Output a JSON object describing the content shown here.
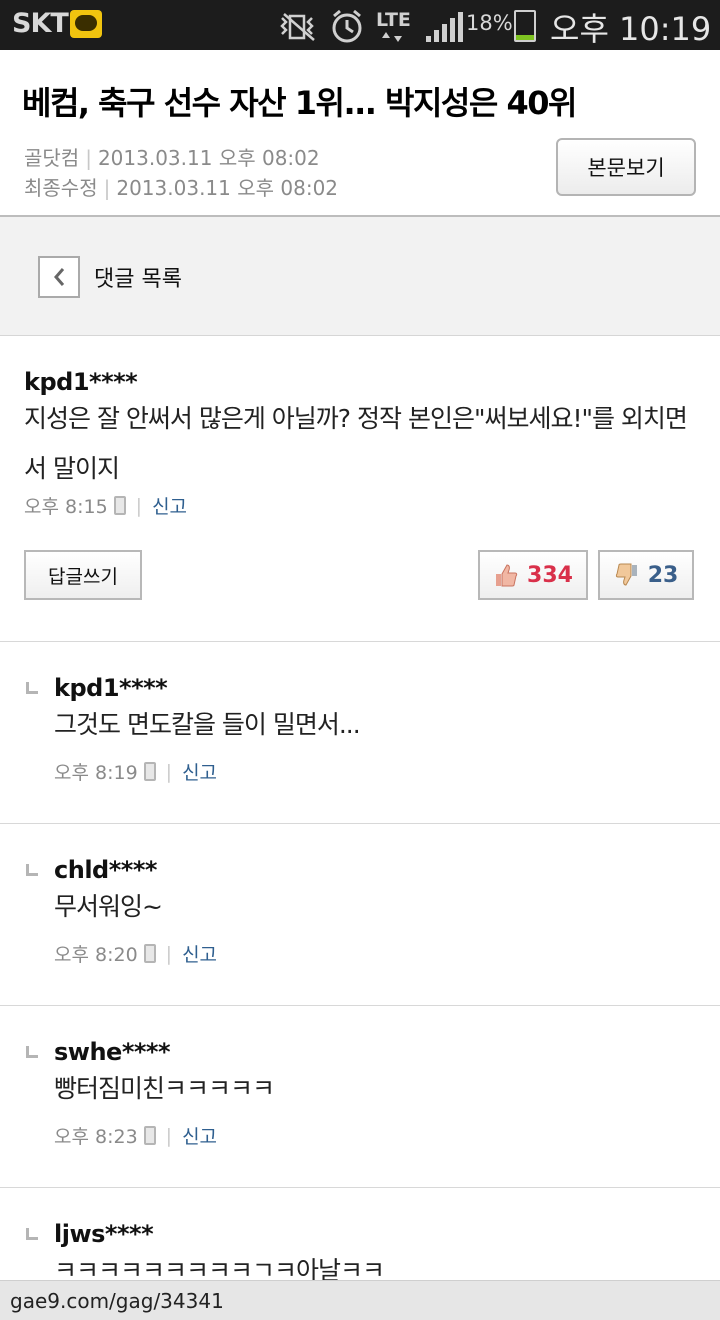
{
  "status_bar": {
    "carrier": "SKT",
    "battery_percent": "18%",
    "battery_level": 0.18,
    "battery_color": "#7ec321",
    "time": "오후 10:19",
    "icons": [
      "kakaotalk-icon",
      "vibrate-icon",
      "alarm-icon",
      "lte-icon",
      "signal-icon",
      "battery-icon"
    ],
    "network": "LTE"
  },
  "article": {
    "title": "베컴, 축구 선수 자산 1위... 박지성은 40위",
    "source": "골닷컴",
    "published": "2013.03.11 오후 08:02",
    "modified_label": "최종수정",
    "modified": "2013.03.11 오후 08:02",
    "view_button": "본문보기"
  },
  "list_header": {
    "title": "댓글 목록"
  },
  "comment": {
    "user": "kpd1****",
    "text": "지성은 잘 안써서 많은게 아닐까? 정작 본인은\"써보세요!\"를 외치면서 말이지",
    "time": "오후 8:15",
    "report": "신고",
    "reply_button": "답글쓰기",
    "likes": "334",
    "dislikes": "23",
    "like_color": "#d9304a",
    "dislike_color": "#3a5f8a"
  },
  "replies": [
    {
      "user": "kpd1****",
      "text": "그것도 면도칼을 들이 밀면서...",
      "time": "오후 8:19",
      "report": "신고"
    },
    {
      "user": "chld****",
      "text": "무서워잉~",
      "time": "오후 8:20",
      "report": "신고"
    },
    {
      "user": "swhe****",
      "text": "빵터짐미친ㅋㅋㅋㅋㅋ",
      "time": "오후 8:23",
      "report": "신고"
    },
    {
      "user": "ljws****",
      "text": "ㅋㅋㅋㅋㅋㅋㅋㅋㅋㄱㅋ아날ㅋㅋ"
    }
  ],
  "url_bar": {
    "url": "gae9.com/gag/34341"
  }
}
